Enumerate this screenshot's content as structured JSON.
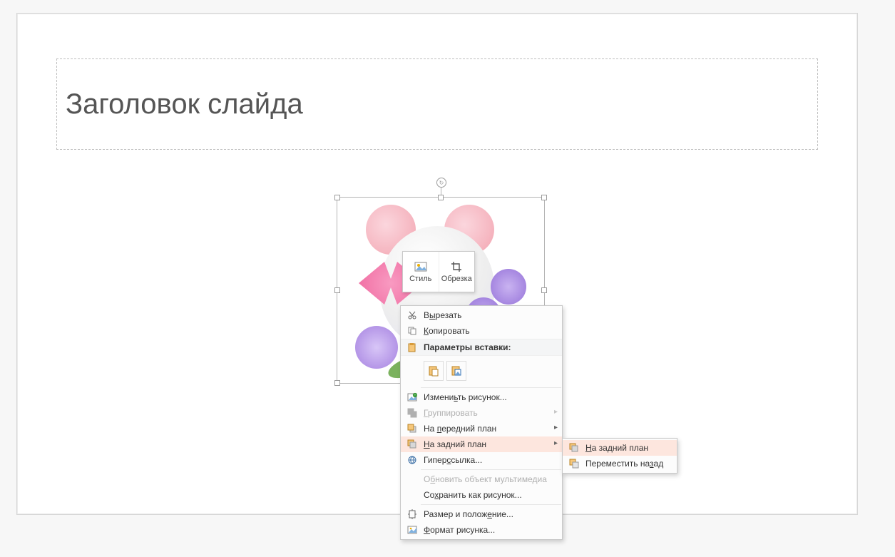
{
  "slide": {
    "title_placeholder": "Заголовок слайда"
  },
  "mini_toolbar": {
    "style_label": "Стиль",
    "crop_label": "Обрезка"
  },
  "context_menu": {
    "cut": "Вырезать",
    "copy": "Копировать",
    "paste_opts_header": "Параметры вставки:",
    "change_picture": "Изменить рисунок...",
    "group": "Группировать",
    "bring_front": "На передний план",
    "send_back": "На задний план",
    "hyperlink": "Гиперссылка...",
    "update_media": "Обновить объект мультимедиа",
    "save_as_picture": "Сохранить как рисунок...",
    "size_position": "Размер и положение...",
    "format_picture": "Формат рисунка..."
  },
  "submenu": {
    "send_back_all": "На задний план",
    "send_backward": "Переместить назад"
  },
  "underline": {
    "cut": "ы",
    "copy": "К",
    "change": "ь",
    "group": "Г",
    "front": "п",
    "back": "Н",
    "hyper": "с",
    "update": "б",
    "save": "х",
    "size": "е",
    "format": "Ф",
    "sub_back": "Н",
    "sub_backward": "з"
  }
}
